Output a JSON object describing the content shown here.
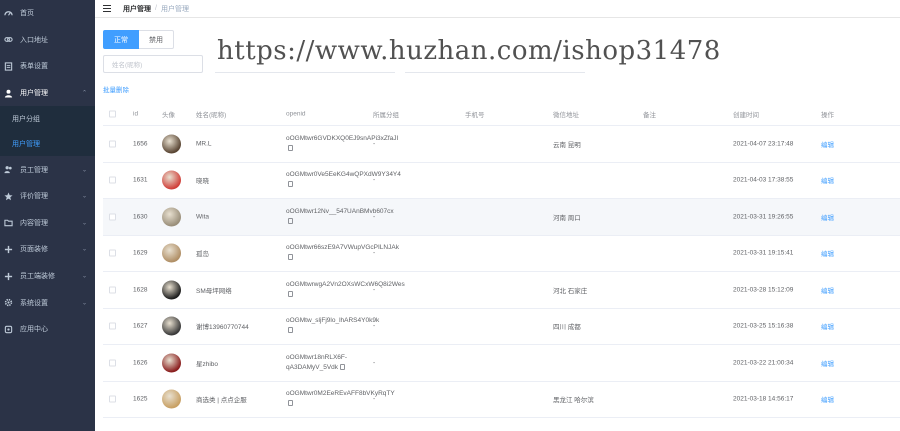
{
  "sidebar": {
    "items": [
      {
        "label": "首页",
        "icon": "gauge-icon"
      },
      {
        "label": "入口地址",
        "icon": "link-icon"
      },
      {
        "label": "表单设置",
        "icon": "form-icon"
      },
      {
        "label": "用户管理",
        "icon": "user-icon"
      },
      {
        "label": "员工管理",
        "icon": "team-icon"
      },
      {
        "label": "评价管理",
        "icon": "star-icon"
      },
      {
        "label": "内容管理",
        "icon": "folder-icon"
      },
      {
        "label": "页面装修",
        "icon": "plus-icon"
      },
      {
        "label": "员工端装修",
        "icon": "plus-icon"
      },
      {
        "label": "系统设置",
        "icon": "gear-icon"
      },
      {
        "label": "应用中心",
        "icon": "app-icon"
      }
    ],
    "sub_items": [
      {
        "label": "用户分组"
      },
      {
        "label": "用户管理"
      }
    ]
  },
  "breadcrumb": {
    "parent": "用户管理",
    "separator": "/",
    "current": "用户管理"
  },
  "tabs": [
    {
      "label": "正常"
    },
    {
      "label": "禁用"
    }
  ],
  "search": {
    "placeholder": "姓名(昵称)"
  },
  "batch_delete": "批量删除",
  "watermark": "https://www.huzhan.com/ishop31478",
  "table": {
    "headers": [
      "id",
      "头像",
      "姓名(昵称)",
      "openid",
      "所属分组",
      "手机号",
      "微信地址",
      "备注",
      "创建时间",
      "操作"
    ],
    "rows": [
      {
        "id": "1656",
        "name": "MR.L",
        "openid": "oOGMtwr6GVDKXQ0EJ9snAPi3xZfaJI",
        "group": "-",
        "phone": "",
        "address": "云南 昆明",
        "created": "2021-04-07 23:17:48",
        "action": "编辑",
        "avatar": "#5a4634"
      },
      {
        "id": "1631",
        "name": "晓晓",
        "openid": "oOGMtwr0Ve5EeKG4wQPXdW9Y34Y4",
        "group": "-",
        "phone": "",
        "address": "",
        "created": "2021-04-03 17:38:55",
        "action": "编辑",
        "avatar": "#d0403a"
      },
      {
        "id": "1630",
        "name": "Wita",
        "openid": "oOGMtwr12Nv__547UAnBMvb607cx",
        "group": "-",
        "phone": "",
        "address": "河南 周口",
        "created": "2021-03-31 19:26:55",
        "action": "编辑",
        "avatar": "#9a8f7a"
      },
      {
        "id": "1629",
        "name": "孤岛",
        "openid": "oOGMtwr66szE9A7VWupVGcPILNJAk",
        "group": "-",
        "phone": "",
        "address": "",
        "created": "2021-03-31 19:15:41",
        "action": "编辑",
        "avatar": "#b08f66"
      },
      {
        "id": "1628",
        "name": "SM母坪网络",
        "openid": "oOGMtwrwgA2Vn2OXsWCxW6Q8i2Wes",
        "group": "-",
        "phone": "",
        "address": "河北 石家庄",
        "created": "2021-03-28 15:12:09",
        "action": "编辑",
        "avatar": "#1e1e1e"
      },
      {
        "id": "1627",
        "name": "谢博13960770744",
        "openid": "oOGMtw_sljFj9lo_lhARS4Y0k9k",
        "group": "-",
        "phone": "",
        "address": "四川 成都",
        "created": "2021-03-25 15:16:38",
        "action": "编辑",
        "avatar": "#3a3a3a"
      },
      {
        "id": "1626",
        "name": "星zhibo",
        "openid": "oOGMtwr18nRLX6F-qA3DAMyV_5Vdk",
        "group": "-",
        "phone": "",
        "address": "",
        "created": "2021-03-22 21:00:34",
        "action": "编辑",
        "avatar": "#8a1e1e"
      },
      {
        "id": "1625",
        "name": "商选类 | 点点企服",
        "openid": "oOGMtwr0M2EeREvAFF8bVKyRqTY",
        "group": "-",
        "phone": "",
        "address": "黑龙江 哈尔滨",
        "created": "2021-03-18 14:56:17",
        "action": "编辑",
        "avatar": "#c8a064"
      }
    ]
  }
}
